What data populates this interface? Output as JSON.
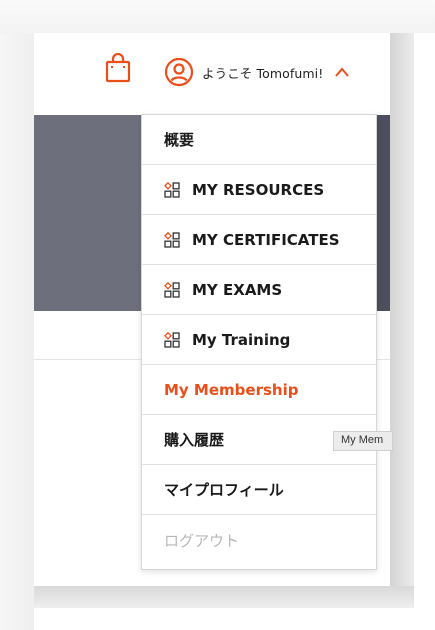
{
  "colors": {
    "accent": "#ea4f1a",
    "hero": "#6e6f7c",
    "text": "#1a1a1a",
    "disabled": "#b7b7b7"
  },
  "header": {
    "cart_icon": "shopping-bag-icon",
    "user_icon": "user-circle-icon",
    "welcome_text": "ようこそ Tomofumi!",
    "toggle_icon": "chevron-up-icon"
  },
  "menu": {
    "items": [
      {
        "label": "概要",
        "icon": null,
        "state": "normal"
      },
      {
        "label": "MY RESOURCES",
        "icon": "grid-diamond-icon",
        "state": "normal"
      },
      {
        "label": "MY CERTIFICATES",
        "icon": "grid-diamond-icon",
        "state": "normal"
      },
      {
        "label": "MY EXAMS",
        "icon": "grid-diamond-icon",
        "state": "normal"
      },
      {
        "label": "My Training",
        "icon": "grid-diamond-icon",
        "state": "normal"
      },
      {
        "label": "My Membership",
        "icon": null,
        "state": "active"
      },
      {
        "label": "購入履歴",
        "icon": null,
        "state": "normal"
      },
      {
        "label": "マイプロフィール",
        "icon": null,
        "state": "normal"
      },
      {
        "label": "ログアウト",
        "icon": null,
        "state": "disabled"
      }
    ]
  },
  "tooltip": {
    "text": "My Mem"
  }
}
